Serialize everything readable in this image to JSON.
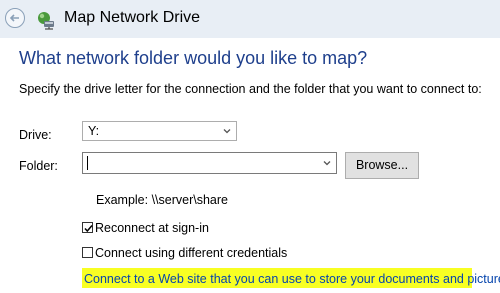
{
  "window": {
    "title": "Map Network Drive"
  },
  "heading": "What network folder would you like to map?",
  "description": "Specify the drive letter for the connection and the folder that you want to connect to:",
  "drive": {
    "label": "Drive:",
    "value": "Y:"
  },
  "folder": {
    "label": "Folder:",
    "value": "",
    "browse_label": "Browse..."
  },
  "example": "Example: \\\\server\\share",
  "options": {
    "reconnect": {
      "label": "Reconnect at sign-in",
      "checked": true
    },
    "credentials": {
      "label": "Connect using different credentials",
      "checked": false
    }
  },
  "link": "Connect to a Web site that you can use to store your documents and pictures.",
  "colors": {
    "heading": "#1e3f8c",
    "link": "#0645ad",
    "highlight": "#f8ff23",
    "titlebar": "#e8eef5"
  },
  "icons": {
    "back": "back-arrow-icon",
    "app": "network-drive-icon",
    "dropdown": "chevron-down-icon",
    "check": "checkmark-icon"
  }
}
